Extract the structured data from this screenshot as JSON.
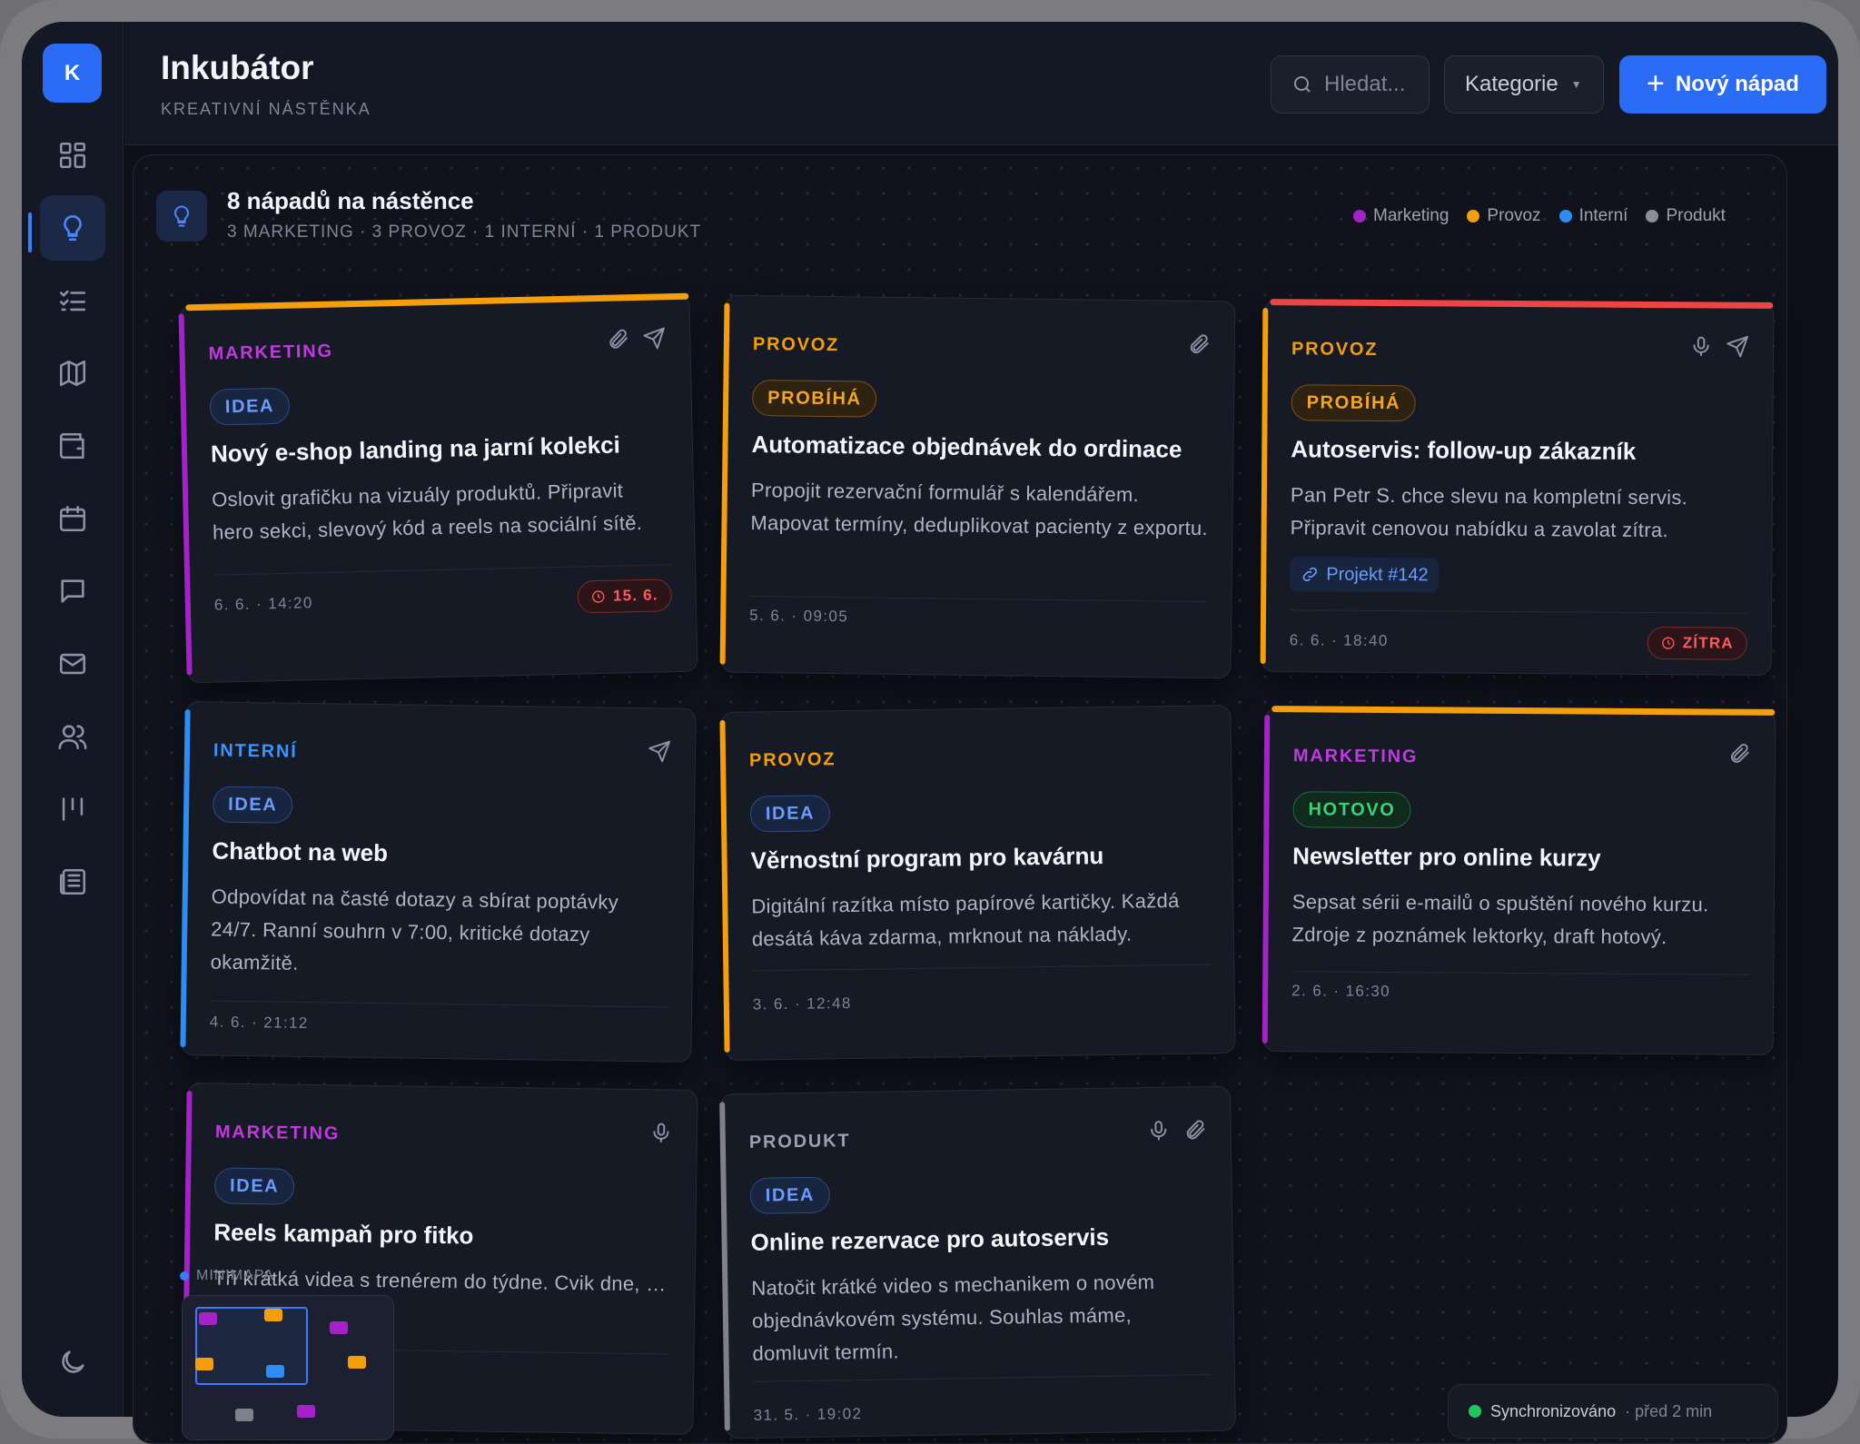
{
  "app": {
    "logo_letter": "K",
    "title": "Inkubátor",
    "subtitle": "KREATIVNÍ NÁSTĚNKA"
  },
  "toolbar": {
    "search_placeholder": "Hledat...",
    "category_label": "Kategorie",
    "new_label": "Nový nápad"
  },
  "sidebar": {
    "items": [
      {
        "icon": "dashboard-icon"
      },
      {
        "icon": "lightbulb-icon",
        "active": true
      },
      {
        "icon": "checklist-icon"
      },
      {
        "icon": "map-icon"
      },
      {
        "icon": "wallet-icon"
      },
      {
        "icon": "calendar-icon"
      },
      {
        "icon": "chat-icon"
      },
      {
        "icon": "mail-icon"
      },
      {
        "icon": "users-icon"
      },
      {
        "icon": "kanban-icon"
      },
      {
        "icon": "newspaper-icon"
      }
    ],
    "bottom_icon": "moon-icon"
  },
  "board": {
    "title": "8 nápadů na nástěnce",
    "summary": "3 MARKETING · 3 PROVOZ · 1 INTERNÍ · 1 PRODUKT",
    "legend": [
      {
        "label": "Marketing",
        "color": "#a323c9"
      },
      {
        "label": "Provoz",
        "color": "#f59e0b"
      },
      {
        "label": "Interní",
        "color": "#2f8cf5"
      },
      {
        "label": "Produkt",
        "color": "#8a8f9c"
      }
    ]
  },
  "colors": {
    "marketing": "#a323c9",
    "provoz": "#f59e0b",
    "interni": "#2f8cf5",
    "produkt": "#7d818c",
    "urgent": "#ef4444",
    "accent": "#2b6cf6"
  },
  "cards": [
    {
      "category": "MARKETING",
      "status": "IDEA",
      "title": "Nový e-shop landing na jarní kolekci",
      "desc": "Oslovit grafičku na vizuály produktů. Připravit hero sekci, slevový kód a reels na sociální sítě.",
      "date": "6. 6. · 14:20",
      "deadline": "15. 6."
    },
    {
      "category": "PROVOZ",
      "status": "PROBÍHÁ",
      "title": "Automatizace objednávek do ordinace",
      "desc": "Propojit rezervační formulář s kalendářem. Mapovat termíny, deduplikovat pacienty z exportu.",
      "date": "5. 6. · 09:05"
    },
    {
      "category": "PROVOZ",
      "status": "PROBÍHÁ",
      "title": "Autoservis: follow-up zákazník",
      "desc": "Pan Petr S. chce slevu na kompletní servis. Připravit cenovou nabídku a zavolat zítra.",
      "project": "Projekt #142",
      "date": "6. 6. · 18:40",
      "deadline": "ZÍTRA"
    },
    {
      "category": "INTERNÍ",
      "status": "IDEA",
      "title": "Chatbot na web",
      "desc": "Odpovídat na časté dotazy a sbírat poptávky 24/7. Ranní souhrn v 7:00, kritické dotazy okamžitě.",
      "date": "4. 6. · 21:12"
    },
    {
      "category": "PROVOZ",
      "status": "IDEA",
      "title": "Věrnostní program pro kavárnu",
      "desc": "Digitální razítka místo papírové kartičky. Každá desátá káva zdarma, mrknout na náklady.",
      "date": "3. 6. · 12:48"
    },
    {
      "category": "MARKETING",
      "status": "HOTOVO",
      "title": "Newsletter pro online kurzy",
      "desc": "Sepsat sérii e-mailů o spuštění nového kurzu. Zdroje z poznámek lektorky, draft hotový.",
      "date": "2. 6. · 16:30"
    },
    {
      "category": "MARKETING",
      "status": "IDEA",
      "title": "Reels kampaň pro fitko",
      "desc": "Tři krátká videa s trenérem do týdne. Cvik dne, … po tréninku.",
      "date": ""
    },
    {
      "category": "PRODUKT",
      "status": "IDEA",
      "title": "Online rezervace pro autoservis",
      "desc": "Natočit krátké video s mechanikem o novém objednávkovém systému. Souhlas máme, domluvit termín.",
      "date": "31. 5. · 19:02"
    }
  ],
  "minimap": {
    "label": "MINIMAPA"
  },
  "sync": {
    "status": "Synchronizováno",
    "time": "· před 2 min"
  }
}
